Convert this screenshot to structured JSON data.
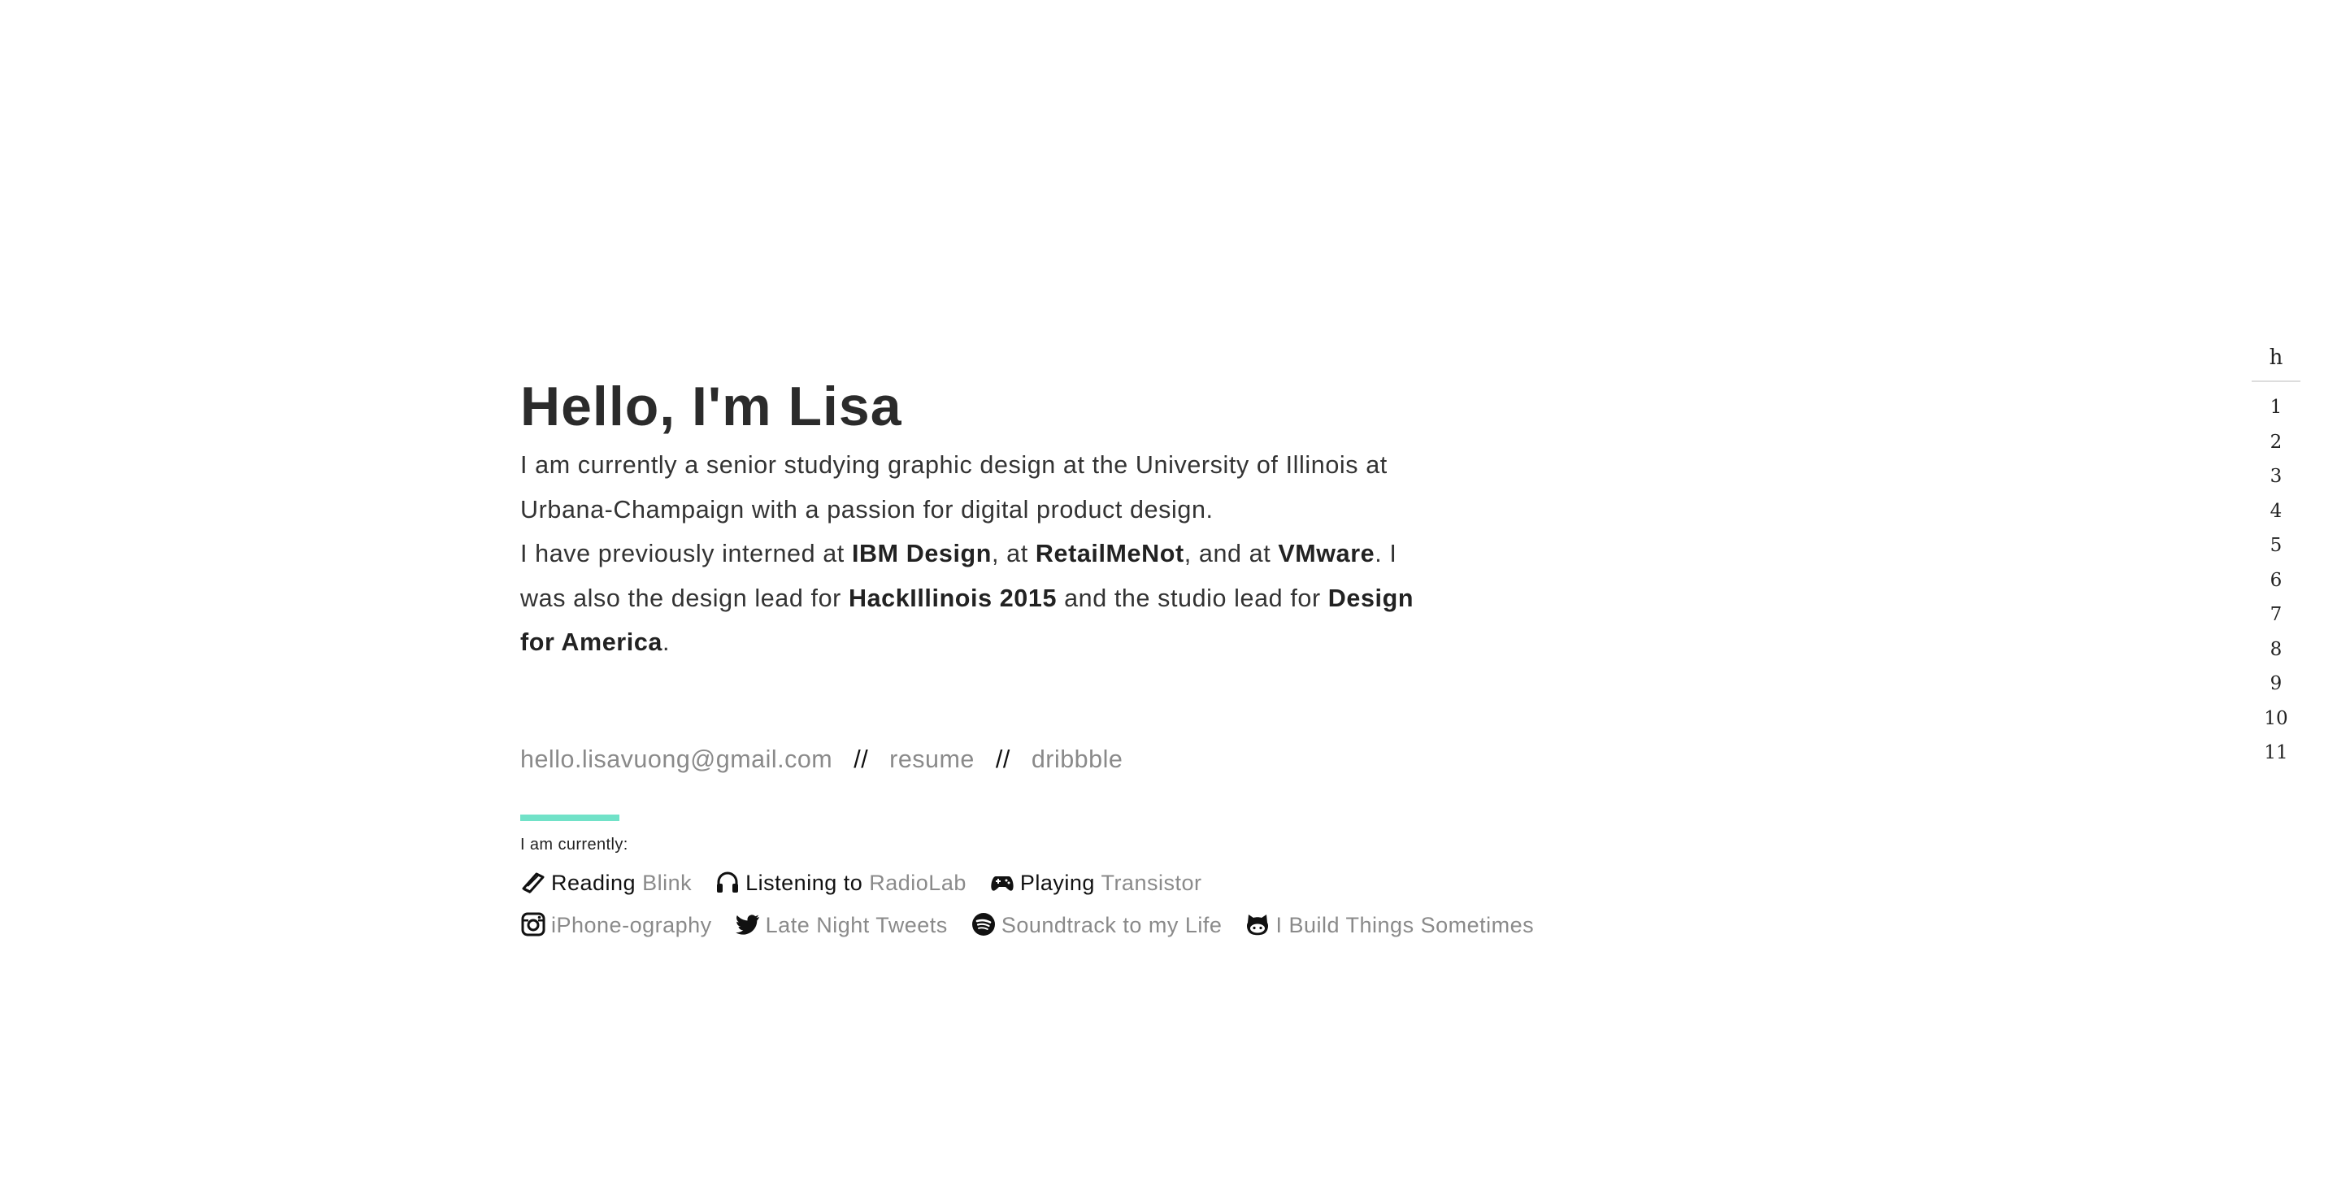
{
  "intro": {
    "title": "Hello, I'm Lisa",
    "p1": "I am currently a senior studying graphic design at the University of Illinois at Urbana-Champaign with a passion for digital product design.",
    "p2": {
      "t1": "I have previously interned at ",
      "b1": "IBM Design",
      "t2": ", at ",
      "b2": "RetailMeNot",
      "t3": ", and at ",
      "b3": "VMware",
      "t4": ". I was also the design lead for ",
      "b4": "HackIllinois 2015",
      "t5": " and the studio lead for ",
      "b5": "Design for America",
      "t6": "."
    }
  },
  "contact": {
    "email": "hello.lisavuong@gmail.com",
    "separator": "//",
    "resume": "resume",
    "dribbble": "dribbble"
  },
  "currently": {
    "label": "I am currently:",
    "row1": [
      {
        "icon": "book-icon",
        "verb": "Reading",
        "value": "Blink"
      },
      {
        "icon": "headphones-icon",
        "verb": "Listening to",
        "value": "RadioLab"
      },
      {
        "icon": "gamepad-icon",
        "verb": "Playing",
        "value": "Transistor"
      }
    ],
    "row2": [
      {
        "icon": "instagram-icon",
        "value": "iPhone-ography"
      },
      {
        "icon": "twitter-icon",
        "value": "Late Night Tweets"
      },
      {
        "icon": "spotify-icon",
        "value": "Soundtrack to my Life"
      },
      {
        "icon": "github-icon",
        "value": "I Build Things Sometimes"
      }
    ]
  },
  "pagenav": {
    "home": "h",
    "items": [
      "1",
      "2",
      "3",
      "4",
      "5",
      "6",
      "7",
      "8",
      "9",
      "10",
      "11"
    ]
  },
  "colors": {
    "accent": "#71e2c8",
    "muted_link": "#8a8a8a",
    "text": "#333333"
  }
}
